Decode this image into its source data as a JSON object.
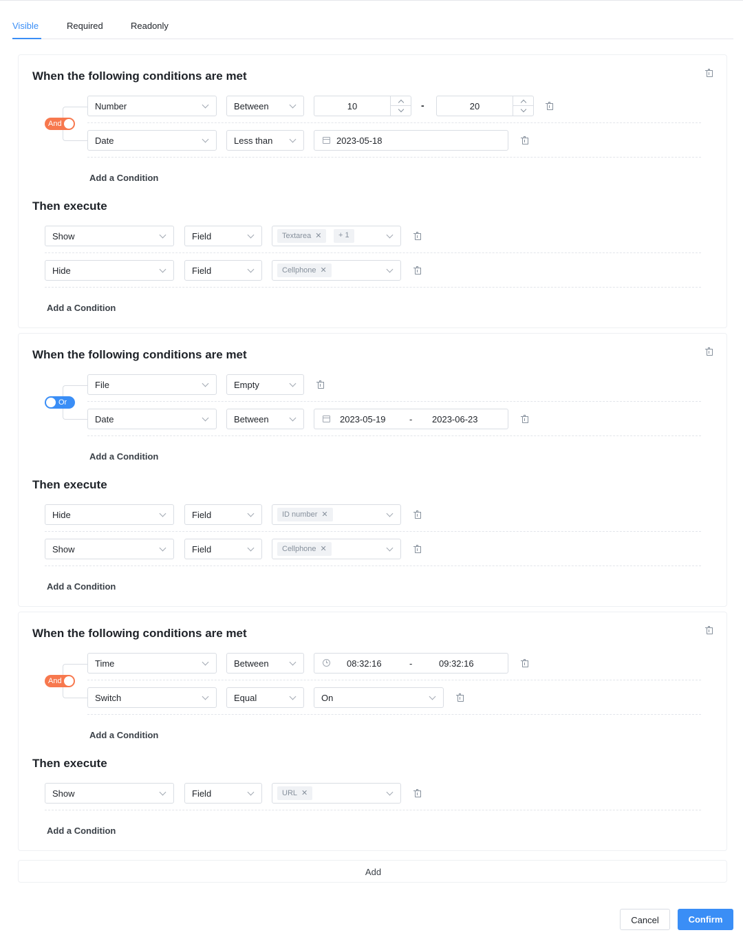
{
  "tabs": [
    "Visible",
    "Required",
    "Readonly"
  ],
  "rule1": {
    "title": "When the following conditions are met",
    "logic": "And",
    "c1": {
      "field": "Number",
      "op": "Between",
      "min": "10",
      "max": "20",
      "sep": "-"
    },
    "c2": {
      "field": "Date",
      "op": "Less than",
      "date": "2023-05-18"
    },
    "add_condition": "Add a Condition",
    "then_title": "Then execute",
    "a1": {
      "action": "Show",
      "target": "Field",
      "tag1": "Textarea",
      "tag2": "+ 1"
    },
    "a2": {
      "action": "Hide",
      "target": "Field",
      "tag1": "Cellphone"
    },
    "add_action": "Add a Condition"
  },
  "rule2": {
    "title": "When the following conditions are met",
    "logic": "Or",
    "c1": {
      "field": "File",
      "op": "Empty"
    },
    "c2": {
      "field": "Date",
      "op": "Between",
      "start": "2023-05-19",
      "sep": "-",
      "end": "2023-06-23"
    },
    "add_condition": "Add a Condition",
    "then_title": "Then execute",
    "a1": {
      "action": "Hide",
      "target": "Field",
      "tag1": "ID number"
    },
    "a2": {
      "action": "Show",
      "target": "Field",
      "tag1": "Cellphone"
    },
    "add_action": "Add a Condition"
  },
  "rule3": {
    "title": "When the following conditions are met",
    "logic": "And",
    "c1": {
      "field": "Time",
      "op": "Between",
      "start": "08:32:16",
      "sep": "-",
      "end": "09:32:16"
    },
    "c2": {
      "field": "Switch",
      "op": "Equal",
      "value": "On"
    },
    "add_condition": "Add a Condition",
    "then_title": "Then execute",
    "a1": {
      "action": "Show",
      "target": "Field",
      "tag1": "URL"
    },
    "add_action": "Add a Condition"
  },
  "add_rule": "Add",
  "cancel": "Cancel",
  "confirm": "Confirm",
  "colors": {
    "accent": "#3a8ef6",
    "and_toggle": "#f7784e",
    "or_toggle": "#3a8ef6"
  },
  "icons": [
    "trash-icon",
    "chevron-down-icon",
    "calendar-icon",
    "clock-icon",
    "close-icon"
  ]
}
